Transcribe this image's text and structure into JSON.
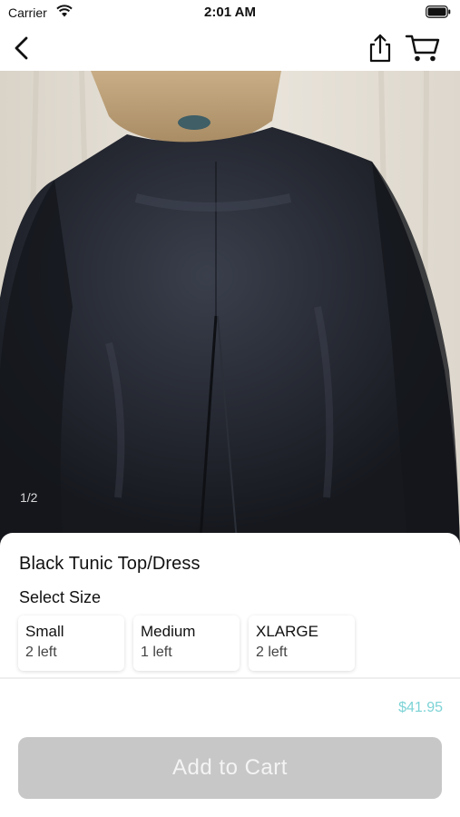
{
  "status_bar": {
    "carrier": "Carrier",
    "time": "2:01 AM"
  },
  "nav": {
    "icons": [
      "back-chevron-icon",
      "share-icon",
      "cart-icon"
    ]
  },
  "image": {
    "counter": "1/2"
  },
  "product": {
    "title": "Black Tunic Top/Dress",
    "select_size_label": "Select Size",
    "sizes": [
      {
        "name": "Small",
        "stock": "2 left"
      },
      {
        "name": "Medium",
        "stock": "1 left"
      },
      {
        "name": "XLARGE",
        "stock": "2 left"
      }
    ],
    "price": "$41.95",
    "add_to_cart_label": "Add to Cart"
  },
  "colors": {
    "price": "#7dd3d6",
    "button_disabled": "#c7c7c7",
    "garment": "#1c1f27"
  }
}
